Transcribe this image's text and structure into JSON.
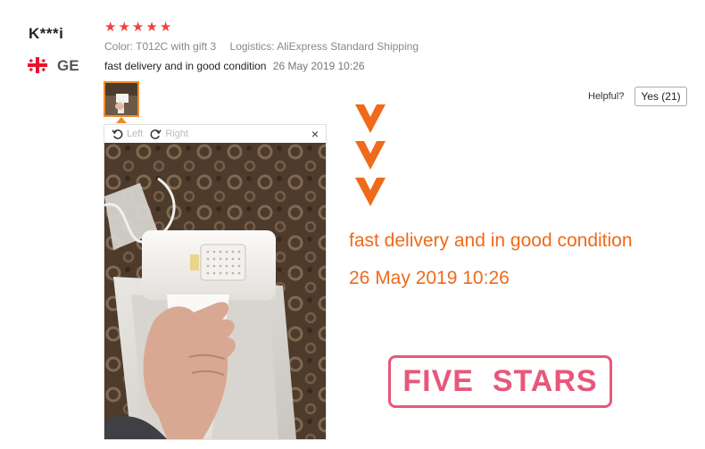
{
  "reviewer": {
    "name": "K***i",
    "country_code": "GE"
  },
  "rating": {
    "stars": 5
  },
  "attributes": {
    "color_label": "Color:",
    "color_value": "T012C with gift 3",
    "logistics_label": "Logistics:",
    "logistics_value": "AliExpress Standard Shipping"
  },
  "review": {
    "text": "fast delivery and in good condition",
    "date": "26 May 2019 10:26"
  },
  "helpful": {
    "label": "Helpful?",
    "yes_button": "Yes (21)"
  },
  "image_viewer": {
    "rotate_left_label": "Left",
    "rotate_right_label": "Right",
    "close_glyph": "×"
  },
  "overlay": {
    "headline": "fast delivery and in good condition",
    "date": "26 May 2019 10:26",
    "badge": "FIVE  STARS"
  },
  "colors": {
    "star": "#f0413d",
    "accent_orange": "#ef6a1a",
    "badge_pink": "#e8577a"
  }
}
